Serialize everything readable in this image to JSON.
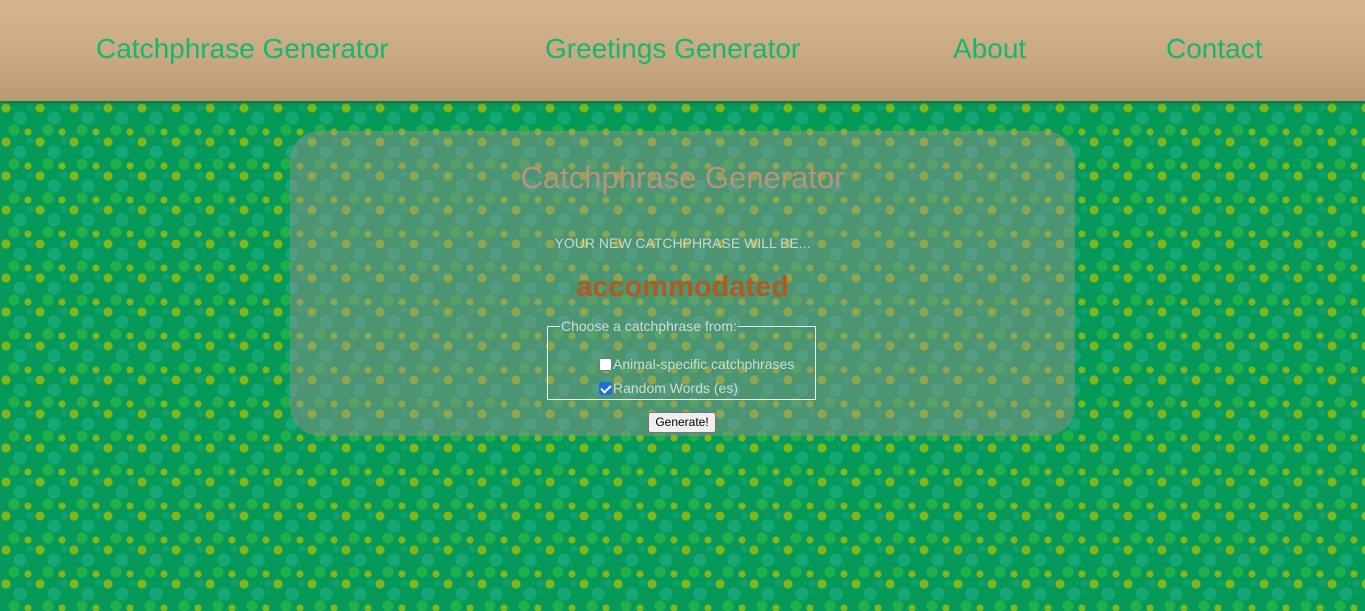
{
  "nav": {
    "items": [
      {
        "label": "Catchphrase Generator"
      },
      {
        "label": "Greetings Generator"
      },
      {
        "label": "About"
      },
      {
        "label": "Contact"
      }
    ]
  },
  "card": {
    "title": "Catchphrase Generator",
    "subtitle": "YOUR NEW CATCHPHRASE WILL BE...",
    "result": "accommodated",
    "options": {
      "legend": "Choose a catchphrase from:",
      "items": [
        {
          "label": "Animal-specific catchphrases",
          "checked": false
        },
        {
          "label": "Random Words (es)",
          "checked": true
        }
      ]
    },
    "generate_label": "Generate!"
  },
  "colors": {
    "nav_link": "#13b774",
    "title": "#b89478",
    "result": "#b25a1e",
    "background": "#069a5a"
  }
}
